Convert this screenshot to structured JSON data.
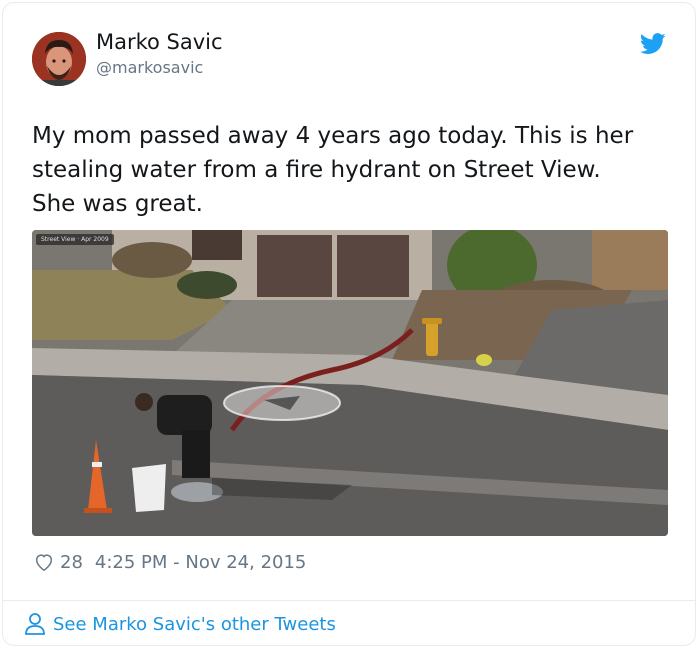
{
  "user": {
    "name": "Marko Savic",
    "handle": "@markosavic"
  },
  "tweet": {
    "text": "My mom passed away 4 years ago today. This is her\nstealing water from a fire hydrant on Street View.\nShe was great."
  },
  "photo": {
    "overlay_label": "Street View · Apr 2009"
  },
  "meta": {
    "likes": "28",
    "timestamp": "4:25 PM - Nov 24, 2015"
  },
  "footer": {
    "link_text": "See Marko Savic's other Tweets"
  },
  "colors": {
    "twitter_blue": "#1da1f2",
    "link_blue": "#1b95e0",
    "secondary_text": "#657786"
  },
  "icons": [
    "avatar",
    "twitter-bird-icon",
    "heart-icon",
    "user-icon"
  ]
}
